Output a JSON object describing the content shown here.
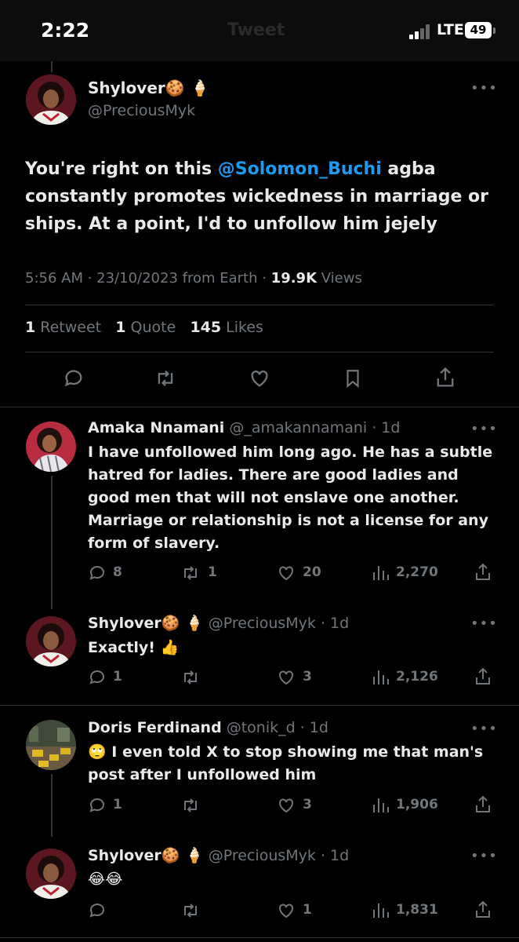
{
  "status_bar": {
    "time": "2:22",
    "ghost_title": "Tweet",
    "network": "LTE",
    "battery": "49"
  },
  "main_tweet": {
    "name": "Shylover🍪 🍦",
    "handle": "@PreciousMyk",
    "text_before": "You're right on this ",
    "mention": "@Solomon_Buchi",
    "text_after": " agba constantly promotes wickedness in marriage or ships. At a point, I'd to unfollow him jejely",
    "meta_time": "5:56 AM · 23/10/2023 from Earth · ",
    "views_count": "19.9K",
    "views_label": " Views",
    "retweets_count": "1",
    "retweets_label": " Retweet",
    "quotes_count": "1",
    "quotes_label": " Quote",
    "likes_count": "145",
    "likes_label": " Likes"
  },
  "replies": [
    {
      "name": "Amaka Nnamani",
      "handle_time": " @_amakannamani · 1d",
      "text": "I have unfollowed him long ago. He has a subtle hatred for ladies. There are good ladies and good men that will not enslave one another. Marriage or relationship is not a license for any form of slavery.",
      "replies": "8",
      "retweets": "1",
      "likes": "20",
      "views": "2,270"
    },
    {
      "name": "Shylover🍪 🍦",
      "handle_time": " @PreciousMyk · 1d",
      "text": "Exactly! 👍",
      "replies": "1",
      "retweets": "",
      "likes": "3",
      "views": "2,126"
    },
    {
      "name": "Doris Ferdinand",
      "handle_time": " @tonik_d · 1d",
      "text": "🙄 I even told X  to stop showing me that man's post after I unfollowed him",
      "replies": "1",
      "retweets": "",
      "likes": "3",
      "views": "1,906"
    },
    {
      "name": "Shylover🍪 🍦",
      "handle_time": " @PreciousMyk · 1d",
      "text": "😂😂",
      "replies": "",
      "retweets": "",
      "likes": "1",
      "views": "1,831"
    }
  ],
  "icons": [
    "reply-icon",
    "retweet-icon",
    "like-icon",
    "bookmark-icon",
    "share-icon",
    "views-icon",
    "more-icon"
  ],
  "colors": {
    "background": "#000000",
    "text": "#e7e9ea",
    "muted": "#71767b",
    "link": "#1d9bf0",
    "divider": "#2f3336"
  }
}
